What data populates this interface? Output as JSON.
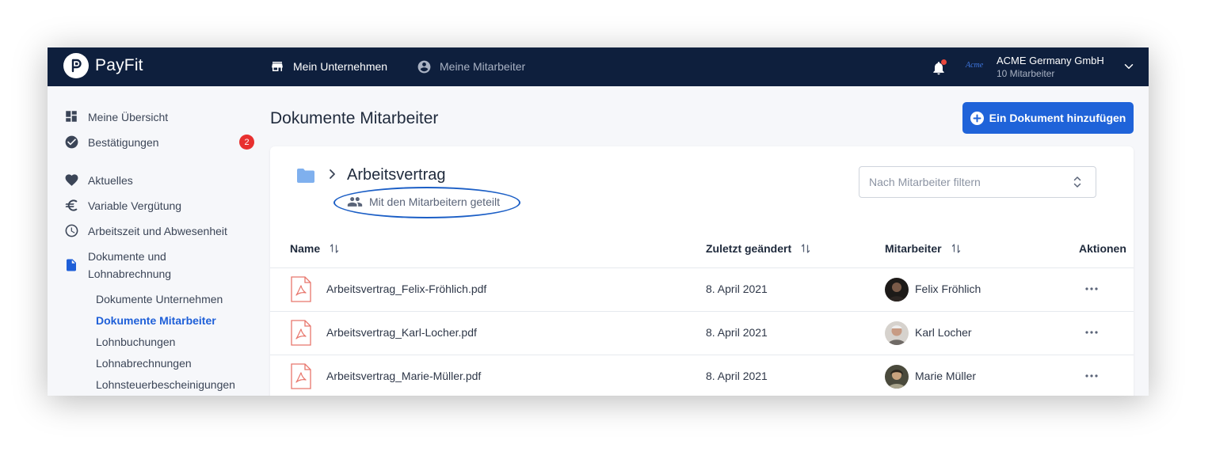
{
  "topbar": {
    "app_name": "PayFit",
    "nav": [
      {
        "label": "Mein Unternehmen",
        "icon": "store-icon",
        "active": true
      },
      {
        "label": "Meine Mitarbeiter",
        "icon": "account-circle-icon",
        "active": false
      }
    ],
    "account": {
      "logo_text": "Acme",
      "company": "ACME Germany GmbH",
      "employees": "10 Mitarbeiter"
    }
  },
  "sidebar": {
    "items": [
      {
        "label": "Meine Übersicht",
        "icon": "dashboard-icon"
      },
      {
        "label": "Bestätigungen",
        "icon": "check-circle-icon",
        "badge": "2"
      },
      {
        "label": "Aktuelles",
        "icon": "heart-icon"
      },
      {
        "label": "Variable Vergütung",
        "icon": "euro-icon"
      },
      {
        "label": "Arbeitszeit und Abwesenheit",
        "icon": "clock-icon"
      },
      {
        "label": "Dokumente und Lohnabrechnung",
        "icon": "document-icon"
      }
    ],
    "sub_items": [
      {
        "label": "Dokumente Unternehmen",
        "active": false
      },
      {
        "label": "Dokumente Mitarbeiter",
        "active": true
      },
      {
        "label": "Lohnbuchungen",
        "active": false
      },
      {
        "label": "Lohnabrechnungen",
        "active": false
      },
      {
        "label": "Lohnsteuerbescheinigungen",
        "active": false
      }
    ]
  },
  "main": {
    "title": "Dokumente Mitarbeiter",
    "add_button": "Ein Dokument hinzufügen",
    "folder": {
      "name": "Arbeitsvertrag",
      "shared": "Mit den Mitarbeitern geteilt"
    },
    "filter": {
      "placeholder": "Nach Mitarbeiter filtern"
    },
    "table": {
      "columns": [
        "Name",
        "Zuletzt geändert",
        "Mitarbeiter",
        "Aktionen"
      ],
      "rows": [
        {
          "file": "Arbeitsvertrag_Felix-Fröhlich.pdf",
          "date": "8. April 2021",
          "employee": "Felix Fröhlich"
        },
        {
          "file": "Arbeitsvertrag_Karl-Locher.pdf",
          "date": "8. April 2021",
          "employee": "Karl Locher"
        },
        {
          "file": "Arbeitsvertrag_Marie-Müller.pdf",
          "date": "8. April 2021",
          "employee": "Marie Müller"
        }
      ]
    }
  },
  "colors": {
    "topbar": "#0e1f3d",
    "accent": "#1f63d9",
    "badge": "#e8302f",
    "folder": "#7fb0ee",
    "pdf": "#e8766c"
  }
}
